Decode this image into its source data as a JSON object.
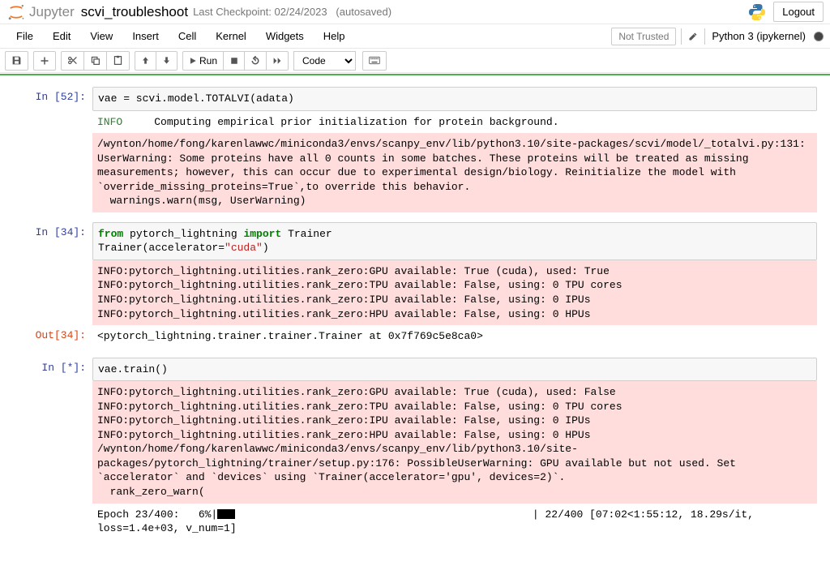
{
  "header": {
    "logoText": "Jupyter",
    "notebookName": "scvi_troubleshoot",
    "checkpoint": "Last Checkpoint: 02/24/2023",
    "autosaved": "(autosaved)",
    "logout": "Logout"
  },
  "menu": {
    "items": [
      "File",
      "Edit",
      "View",
      "Insert",
      "Cell",
      "Kernel",
      "Widgets",
      "Help"
    ],
    "notTrusted": "Not Trusted",
    "kernelName": "Python 3 (ipykernel)"
  },
  "toolbar": {
    "runLabel": "Run",
    "cellType": "Code"
  },
  "cells": {
    "c0": {
      "inPrompt": "In [52]:",
      "code": "vae = scvi.model.TOTALVI(adata)",
      "infoLabel": "INFO    ",
      "infoText": " Computing empirical prior initialization for protein background.",
      "stderr": "/wynton/home/fong/karenlawwc/miniconda3/envs/scanpy_env/lib/python3.10/site-packages/scvi/model/_totalvi.py:131: UserWarning: Some proteins have all 0 counts in some batches. These proteins will be treated as missing measurements; however, this can occur due to experimental design/biology. Reinitialize the model with `override_missing_proteins=True`,to override this behavior.\n  warnings.warn(msg, UserWarning)"
    },
    "c1": {
      "inPrompt": "In [34]:",
      "stderr": "INFO:pytorch_lightning.utilities.rank_zero:GPU available: True (cuda), used: True\nINFO:pytorch_lightning.utilities.rank_zero:TPU available: False, using: 0 TPU cores\nINFO:pytorch_lightning.utilities.rank_zero:IPU available: False, using: 0 IPUs\nINFO:pytorch_lightning.utilities.rank_zero:HPU available: False, using: 0 HPUs",
      "outPrompt": "Out[34]:",
      "outText": "<pytorch_lightning.trainer.trainer.Trainer at 0x7f769c5e8ca0>"
    },
    "c2": {
      "inPrompt": "In [*]:",
      "code": "vae.train()",
      "stderr": "INFO:pytorch_lightning.utilities.rank_zero:GPU available: True (cuda), used: False\nINFO:pytorch_lightning.utilities.rank_zero:TPU available: False, using: 0 TPU cores\nINFO:pytorch_lightning.utilities.rank_zero:IPU available: False, using: 0 IPUs\nINFO:pytorch_lightning.utilities.rank_zero:HPU available: False, using: 0 HPUs\n/wynton/home/fong/karenlawwc/miniconda3/envs/scanpy_env/lib/python3.10/site-packages/pytorch_lightning/trainer/setup.py:176: PossibleUserWarning: GPU available but not used. Set `accelerator` and `devices` using `Trainer(accelerator='gpu', devices=2)`.\n  rank_zero_warn(",
      "progressA": "Epoch 23/400:   6%|",
      "progressB": "                                               | 22/400 [07:02<1:55:12, 18.29s/it, loss=1.4e+03, v_num=1]"
    }
  }
}
